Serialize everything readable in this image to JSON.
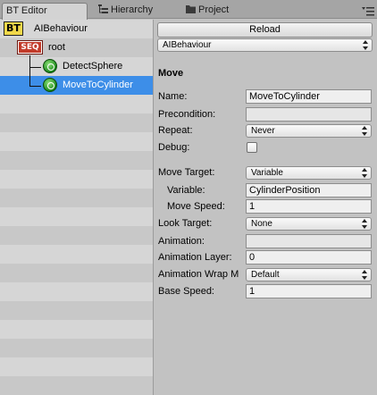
{
  "tabs": [
    {
      "label": "BT Editor"
    },
    {
      "label": "Hierarchy"
    },
    {
      "label": "Project"
    }
  ],
  "tree": {
    "root_asset": {
      "label": "AIBehaviour",
      "badge": "BT"
    },
    "sequence": {
      "label": "root",
      "badge": "SEQ"
    },
    "children": [
      {
        "label": "DetectSphere"
      },
      {
        "label": "MoveToCylinder",
        "selected": true
      }
    ]
  },
  "inspector": {
    "reload_label": "Reload",
    "behaviour_select": "AIBehaviour",
    "section_title": "Move",
    "fields": {
      "name": {
        "label": "Name:",
        "value": "MoveToCylinder"
      },
      "precondition": {
        "label": "Precondition:",
        "value": ""
      },
      "repeat": {
        "label": "Repeat:",
        "value": "Never"
      },
      "debug": {
        "label": "Debug:",
        "checked": false
      },
      "move_target": {
        "label": "Move Target:",
        "value": "Variable"
      },
      "variable": {
        "label": "Variable:",
        "value": "CylinderPosition"
      },
      "move_speed": {
        "label": "Move Speed:",
        "value": "1"
      },
      "look_target": {
        "label": "Look Target:",
        "value": "None"
      },
      "animation": {
        "label": "Animation:",
        "value": ""
      },
      "animation_layer": {
        "label": "Animation Layer:",
        "value": "0"
      },
      "animation_wrap": {
        "label": "Animation Wrap M",
        "value": "Default"
      },
      "base_speed": {
        "label": "Base Speed:",
        "value": "1"
      }
    }
  },
  "colors": {
    "selection": "#3d8ee8",
    "bt_badge": "#f1d84a",
    "seq_badge": "#c23b2a"
  },
  "icons": [
    "hierarchy-icon",
    "folder-icon",
    "panel-menu-icon",
    "bt-badge",
    "seq-badge",
    "action-node-icon",
    "popup-arrows-icon"
  ]
}
